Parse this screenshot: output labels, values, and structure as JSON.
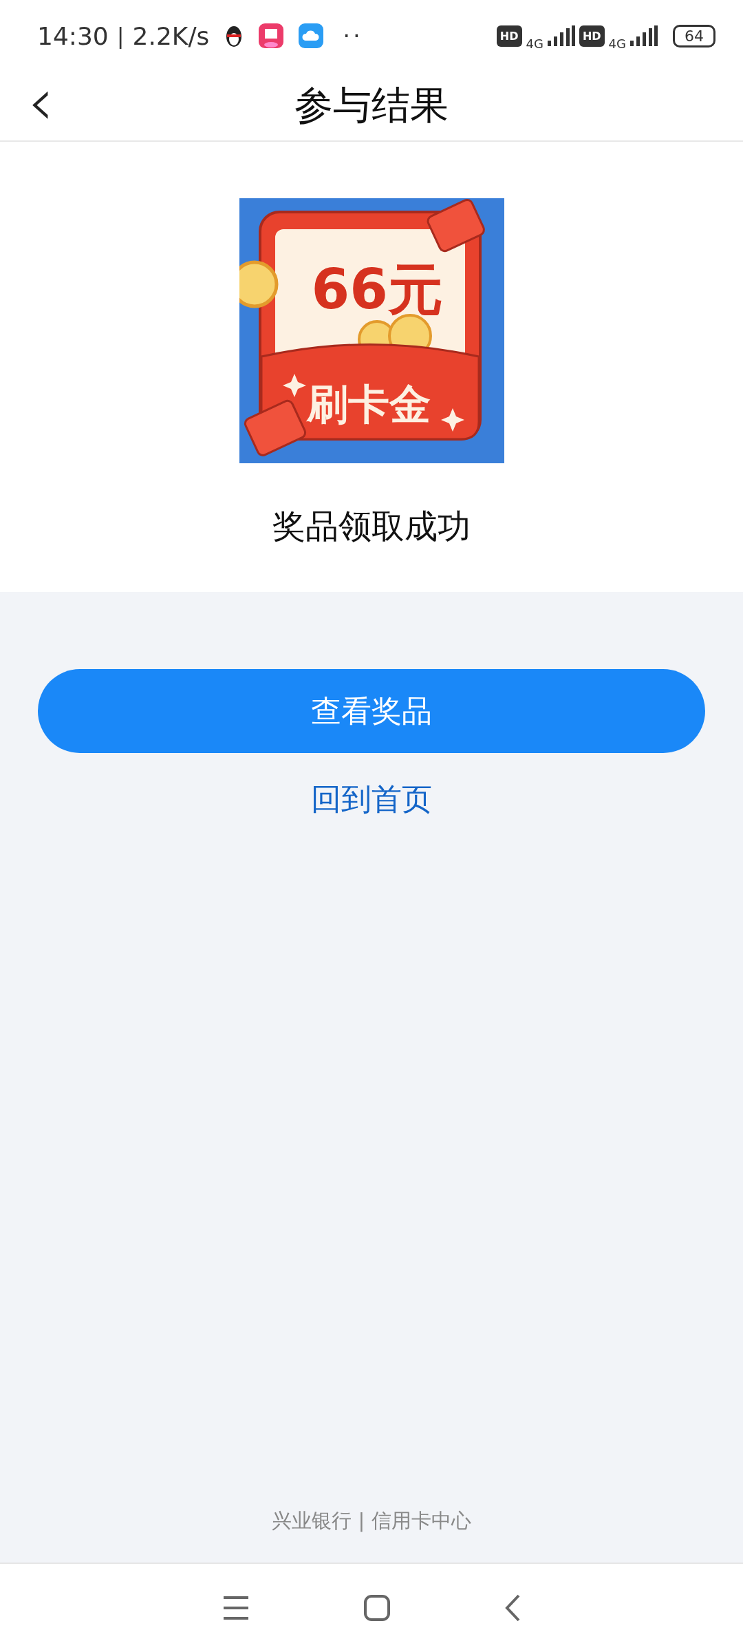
{
  "status_bar": {
    "time": "14:30",
    "separator": "|",
    "speed": "2.2K/s",
    "more": "··",
    "sims": [
      {
        "hd": "HD",
        "network": "4G"
      },
      {
        "hd": "HD",
        "network": "4G"
      }
    ],
    "battery": "64"
  },
  "header": {
    "back": "‹",
    "title": "参与结果"
  },
  "prize": {
    "amount": "66元",
    "name": "刷卡金",
    "message": "奖品领取成功"
  },
  "primary_button": "查看奖品",
  "home_link": "回到首页",
  "footer": "兴业银行 | 信用卡中心"
}
